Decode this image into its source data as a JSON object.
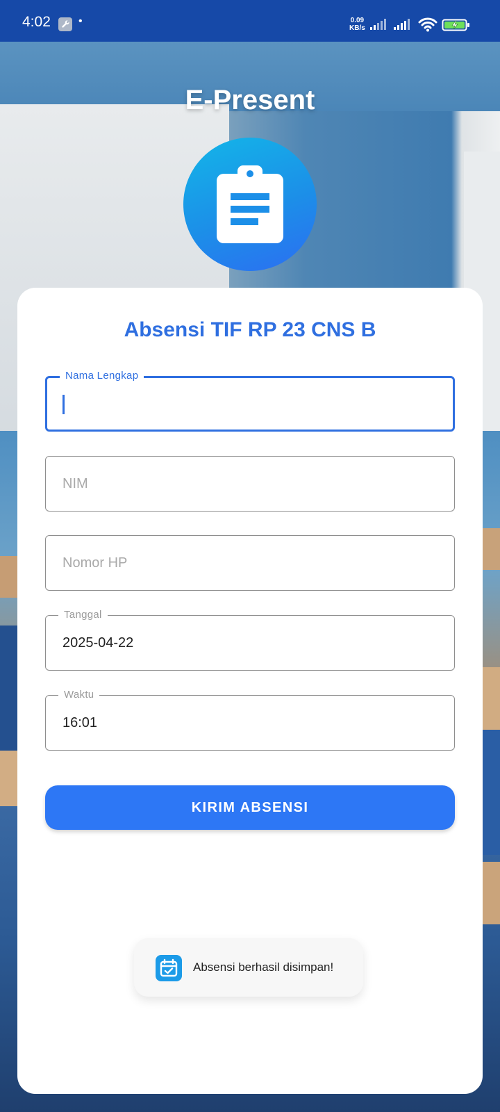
{
  "status_bar": {
    "time": "4:02",
    "net_speed_value": "0.09",
    "net_speed_unit": "KB/s"
  },
  "app": {
    "title": "E-Present",
    "logo_icon": "clipboard-icon"
  },
  "form": {
    "title": "Absensi TIF RP 23 CNS B",
    "fields": [
      {
        "label": "Nama Lengkap",
        "value": "",
        "placeholder": "",
        "focused": true
      },
      {
        "label": "",
        "value": "",
        "placeholder": "NIM"
      },
      {
        "label": "",
        "value": "",
        "placeholder": "Nomor HP"
      },
      {
        "label": "Tanggal",
        "value": "2025-04-22",
        "placeholder": ""
      },
      {
        "label": "Waktu",
        "value": "16:01",
        "placeholder": ""
      }
    ],
    "submit_label": "KIRIM ABSENSI"
  },
  "toast": {
    "icon": "calendar-check-icon",
    "message": "Absensi berhasil disimpan!"
  },
  "colors": {
    "primary": "#2d77f5",
    "title_blue": "#2f6fe0",
    "status_bar": "#1649a8"
  }
}
